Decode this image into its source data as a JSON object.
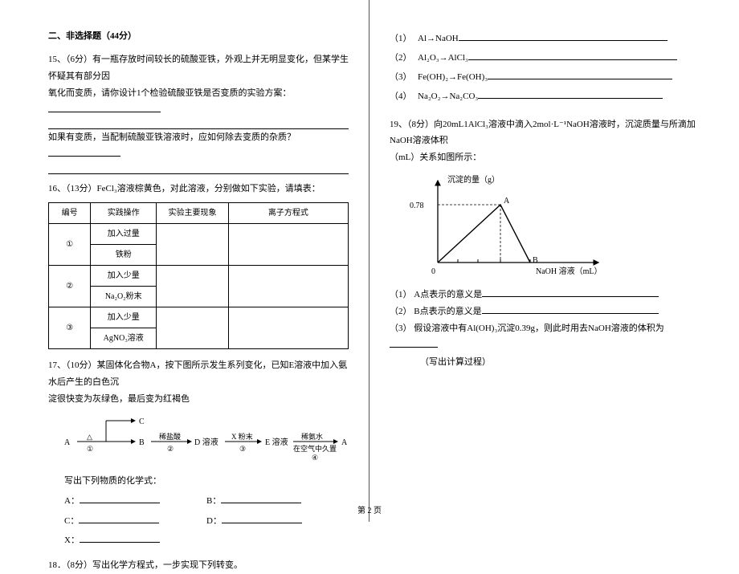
{
  "section_title": "二、非选择题（44分）",
  "q15": {
    "num": "15、",
    "text_a": "（6分）有一瓶存放时间较长的硫酸亚铁，外观上并无明显变化，但某学生怀疑其有部分因",
    "text_b": "氧化而变质，请你设计1个检验硫酸亚铁是否变质的实验方案：",
    "text_c": "如果有变质，当配制硫酸亚铁溶液时，应如何除去变质的杂质？"
  },
  "q16": {
    "num": "16、",
    "text": "（13分）FeCl₃溶液棕黄色，对此溶液，分别做如下实验，请填表：",
    "headers": [
      "编号",
      "实践操作",
      "实验主要现象",
      "离子方程式"
    ],
    "rows": [
      {
        "id": "①",
        "op_a": "加入过量",
        "op_b": "铁粉"
      },
      {
        "id": "②",
        "op_a": "加入少量",
        "op_b": "Na₂O₂粉末"
      },
      {
        "id": "③",
        "op_a": "加入少量",
        "op_b": "AgNO₃溶液"
      }
    ]
  },
  "q17": {
    "num": "17、",
    "text_a": "（10分）某固体化合物A，按下图所示发生系列变化，已知E溶液中加入氨水后产生的白色沉",
    "text_b": "淀很快变为灰绿色，最后变为红褐色",
    "flow": {
      "A": "A",
      "B": "B",
      "C": "C",
      "D": "D 溶液",
      "E": "E 溶液",
      "step1": "△",
      "step1b": "①",
      "step2": "稀盐酸",
      "step2b": "②",
      "step3": "X 粉末",
      "step3b": "③",
      "step4a": "稀氨水",
      "step4b": "在空气中久置",
      "step4c": "④",
      "end": "A"
    },
    "prompt": "写出下列物质的化学式：",
    "labels": {
      "A": "A：",
      "B": "B：",
      "C": "C：",
      "D": "D：",
      "X": "X："
    }
  },
  "q18": {
    "num": "18．",
    "text": "（8分）写出化学方程式，一步实现下列转变。"
  },
  "eqs": [
    {
      "lbl": "（1）",
      "chem": "Al→NaOH"
    },
    {
      "lbl": "（2）",
      "chem": "Al₂O₃→AlCl₃"
    },
    {
      "lbl": "（3）",
      "chem": "Fe(OH)₂→Fe(OH)₃"
    },
    {
      "lbl": "（4）",
      "chem": "Na₂O₂→Na₂CO₃"
    }
  ],
  "q19": {
    "num": "19、",
    "text_a": "（8分）向20mL1AlCl₃溶液中滴入2mol·L⁻¹NaOH溶液时，沉淀质量与所滴加NaOH溶液体积",
    "text_b": "（mL）关系如图所示：",
    "ylabel": "沉淀的量（g）",
    "ytick": "0.78",
    "origin": "0",
    "ptA": "A",
    "ptB": "B",
    "xlabel": "NaOH 溶液（mL）",
    "sub1": "（1）  A点表示的意义是",
    "sub2": "（2）  B点表示的意义是",
    "sub3a": "（3）  假设溶液中有Al(OH)₃沉淀0.39g，则此时用去NaOH溶液的体积为",
    "sub3b": "（写出计算过程）"
  },
  "footer": "第 2 页",
  "chart_data": {
    "type": "line",
    "title": "",
    "xlabel": "NaOH 溶液（mL）",
    "ylabel": "沉淀的量（g）",
    "series": [
      {
        "name": "precipitate",
        "points": [
          {
            "x": 0,
            "y": 0
          },
          {
            "x_label": "A_x",
            "y": 0.78
          },
          {
            "x_label": "B_x",
            "y": 0
          }
        ]
      }
    ],
    "annotations": [
      {
        "label": "A",
        "y": 0.78
      },
      {
        "label": "B",
        "y": 0
      }
    ],
    "ylim": [
      0,
      0.78
    ]
  }
}
